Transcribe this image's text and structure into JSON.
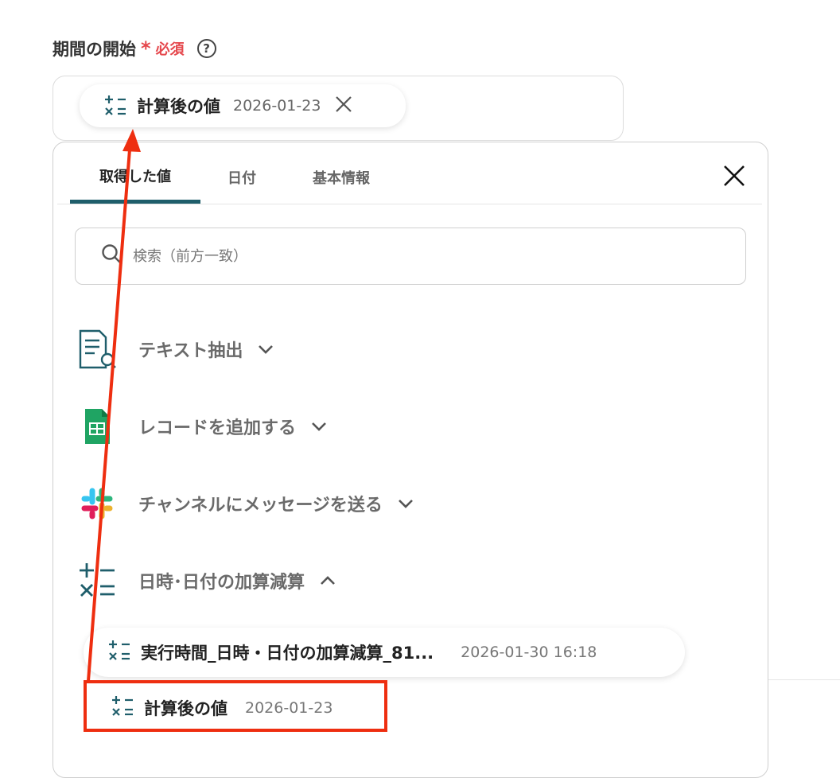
{
  "field": {
    "label": "期間の開始",
    "required_mark": "*",
    "required_text": "必須",
    "help_icon": "question-circle-icon"
  },
  "selected_chip": {
    "icon": "calc-icon",
    "name": "計算後の値",
    "value": "2026-01-23",
    "remove_icon": "close-icon"
  },
  "panel": {
    "tabs": [
      {
        "label": "取得した値",
        "active": true
      },
      {
        "label": "日付",
        "active": false
      },
      {
        "label": "基本情報",
        "active": false
      }
    ],
    "close_icon": "close-icon",
    "search": {
      "placeholder": "検索（前方一致）",
      "icon": "search-icon"
    },
    "groups": [
      {
        "label": "テキスト抽出",
        "icon": "document-search-icon",
        "expanded": false
      },
      {
        "label": "レコードを追加する",
        "icon": "google-sheets-icon",
        "expanded": false
      },
      {
        "label": "チャンネルにメッセージを送る",
        "icon": "slack-icon",
        "expanded": false
      },
      {
        "label": "日時･日付の加算減算",
        "icon": "calc-icon",
        "expanded": true
      }
    ],
    "items": [
      {
        "name": "実行時間_日時・日付の加算減算_81...",
        "value": "2026-01-30 16:18"
      },
      {
        "name": "計算後の値",
        "value": "2026-01-23"
      }
    ]
  },
  "colors": {
    "accent": "#1f5e6b",
    "required": "#e5484d",
    "annotation": "#ee2e10"
  }
}
